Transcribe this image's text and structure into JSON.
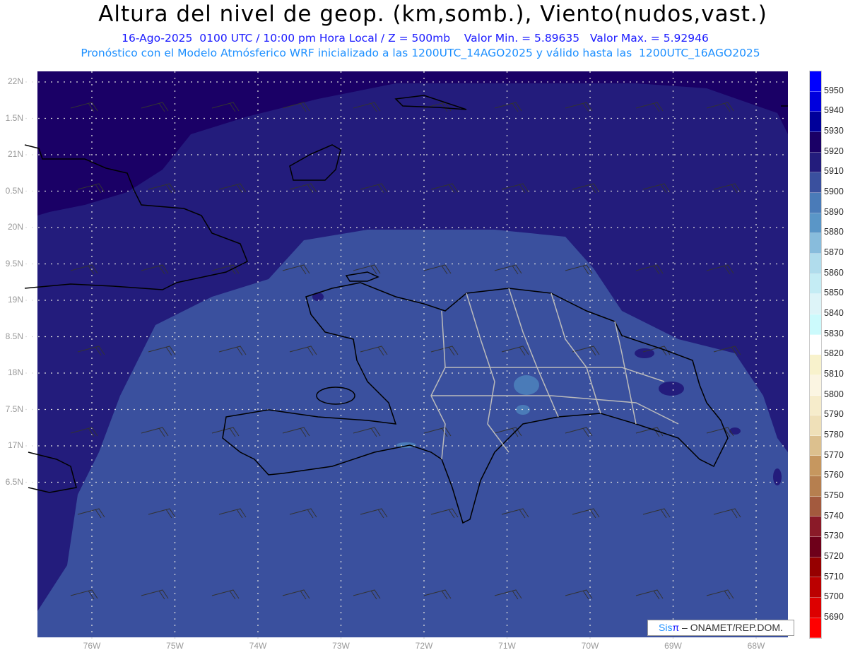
{
  "header": {
    "title": "Altura del nivel de geop. (km,somb.), Viento(nudos,vast.)",
    "line1": "16-Ago-2025  0100 UTC / 10:00 pm Hora Local / Z = 500mb    Valor Min. = 5.89635   Valor Max. = 5.92946",
    "line2": "Pronóstico con el Modelo Atmósferico WRF inicializado a las 1200UTC_14AGO2025 y válido hasta las  1200UTC_16AGO2025"
  },
  "axes": {
    "lat_labels": [
      "22N",
      "1.5N",
      "21N",
      "0.5N",
      "20N",
      "9.5N",
      "19N",
      "8.5N",
      "18N",
      "7.5N",
      "17N",
      "6.5N"
    ],
    "lon_labels": [
      "76W",
      "75W",
      "74W",
      "73W",
      "72W",
      "71W",
      "70W",
      "69W",
      "68W"
    ]
  },
  "colorbar": {
    "labels": [
      "5950",
      "5940",
      "5930",
      "5920",
      "5910",
      "5900",
      "5890",
      "5880",
      "5870",
      "5860",
      "5850",
      "5840",
      "5830",
      "5820",
      "5810",
      "5800",
      "5790",
      "5780",
      "5770",
      "5760",
      "5750",
      "5740",
      "5730",
      "5720",
      "5710",
      "5700",
      "5690"
    ],
    "colors": [
      "#0000ff",
      "#0000dd",
      "#00009a",
      "#1a0066",
      "#231c7c",
      "#3a509e",
      "#4a7bb8",
      "#5a96c7",
      "#88bcdc",
      "#b0dcec",
      "#c4ecf4",
      "#ddf4f8",
      "#ccfafc",
      "#ffffff",
      "#f8f2cc",
      "#fbf5e2",
      "#f6eccb",
      "#efe0b8",
      "#dcc08e",
      "#c6975f",
      "#b67f4f",
      "#a35a3e",
      "#8a1a28",
      "#6e001a",
      "#960000",
      "#bb0000",
      "#dd0000",
      "#ff0000"
    ]
  },
  "map_colors": {
    "high": "#1a0066",
    "mid": "#231c7c",
    "low": "#3a509e",
    "patch": "#4a7bb8"
  },
  "logo": {
    "sis": "Sis",
    "pi": "π",
    "rest": " –  ONAMET/REP.DOM."
  }
}
